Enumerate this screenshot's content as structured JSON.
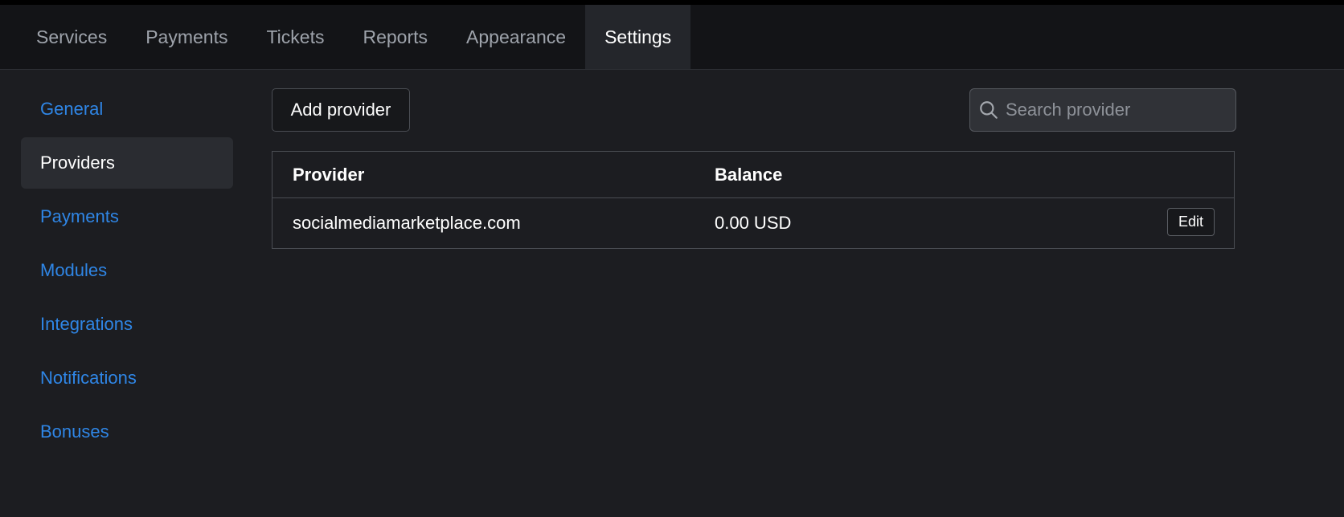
{
  "topnav": {
    "tabs": [
      {
        "label": "Services"
      },
      {
        "label": "Payments"
      },
      {
        "label": "Tickets"
      },
      {
        "label": "Reports"
      },
      {
        "label": "Appearance"
      },
      {
        "label": "Settings",
        "active": true
      }
    ]
  },
  "sidebar": {
    "items": [
      {
        "label": "General"
      },
      {
        "label": "Providers",
        "active": true
      },
      {
        "label": "Payments"
      },
      {
        "label": "Modules"
      },
      {
        "label": "Integrations"
      },
      {
        "label": "Notifications"
      },
      {
        "label": "Bonuses"
      }
    ]
  },
  "toolbar": {
    "add_label": "Add provider",
    "search_placeholder": "Search provider",
    "search_icon": "search-icon"
  },
  "table": {
    "headers": [
      "Provider",
      "Balance"
    ],
    "rows": [
      {
        "provider": "socialmediamarketplace.com",
        "balance": "0.00 USD",
        "edit_label": "Edit"
      }
    ]
  },
  "colors": {
    "link": "#2f86e6",
    "background": "#1c1d21",
    "nav_background": "#131417"
  }
}
